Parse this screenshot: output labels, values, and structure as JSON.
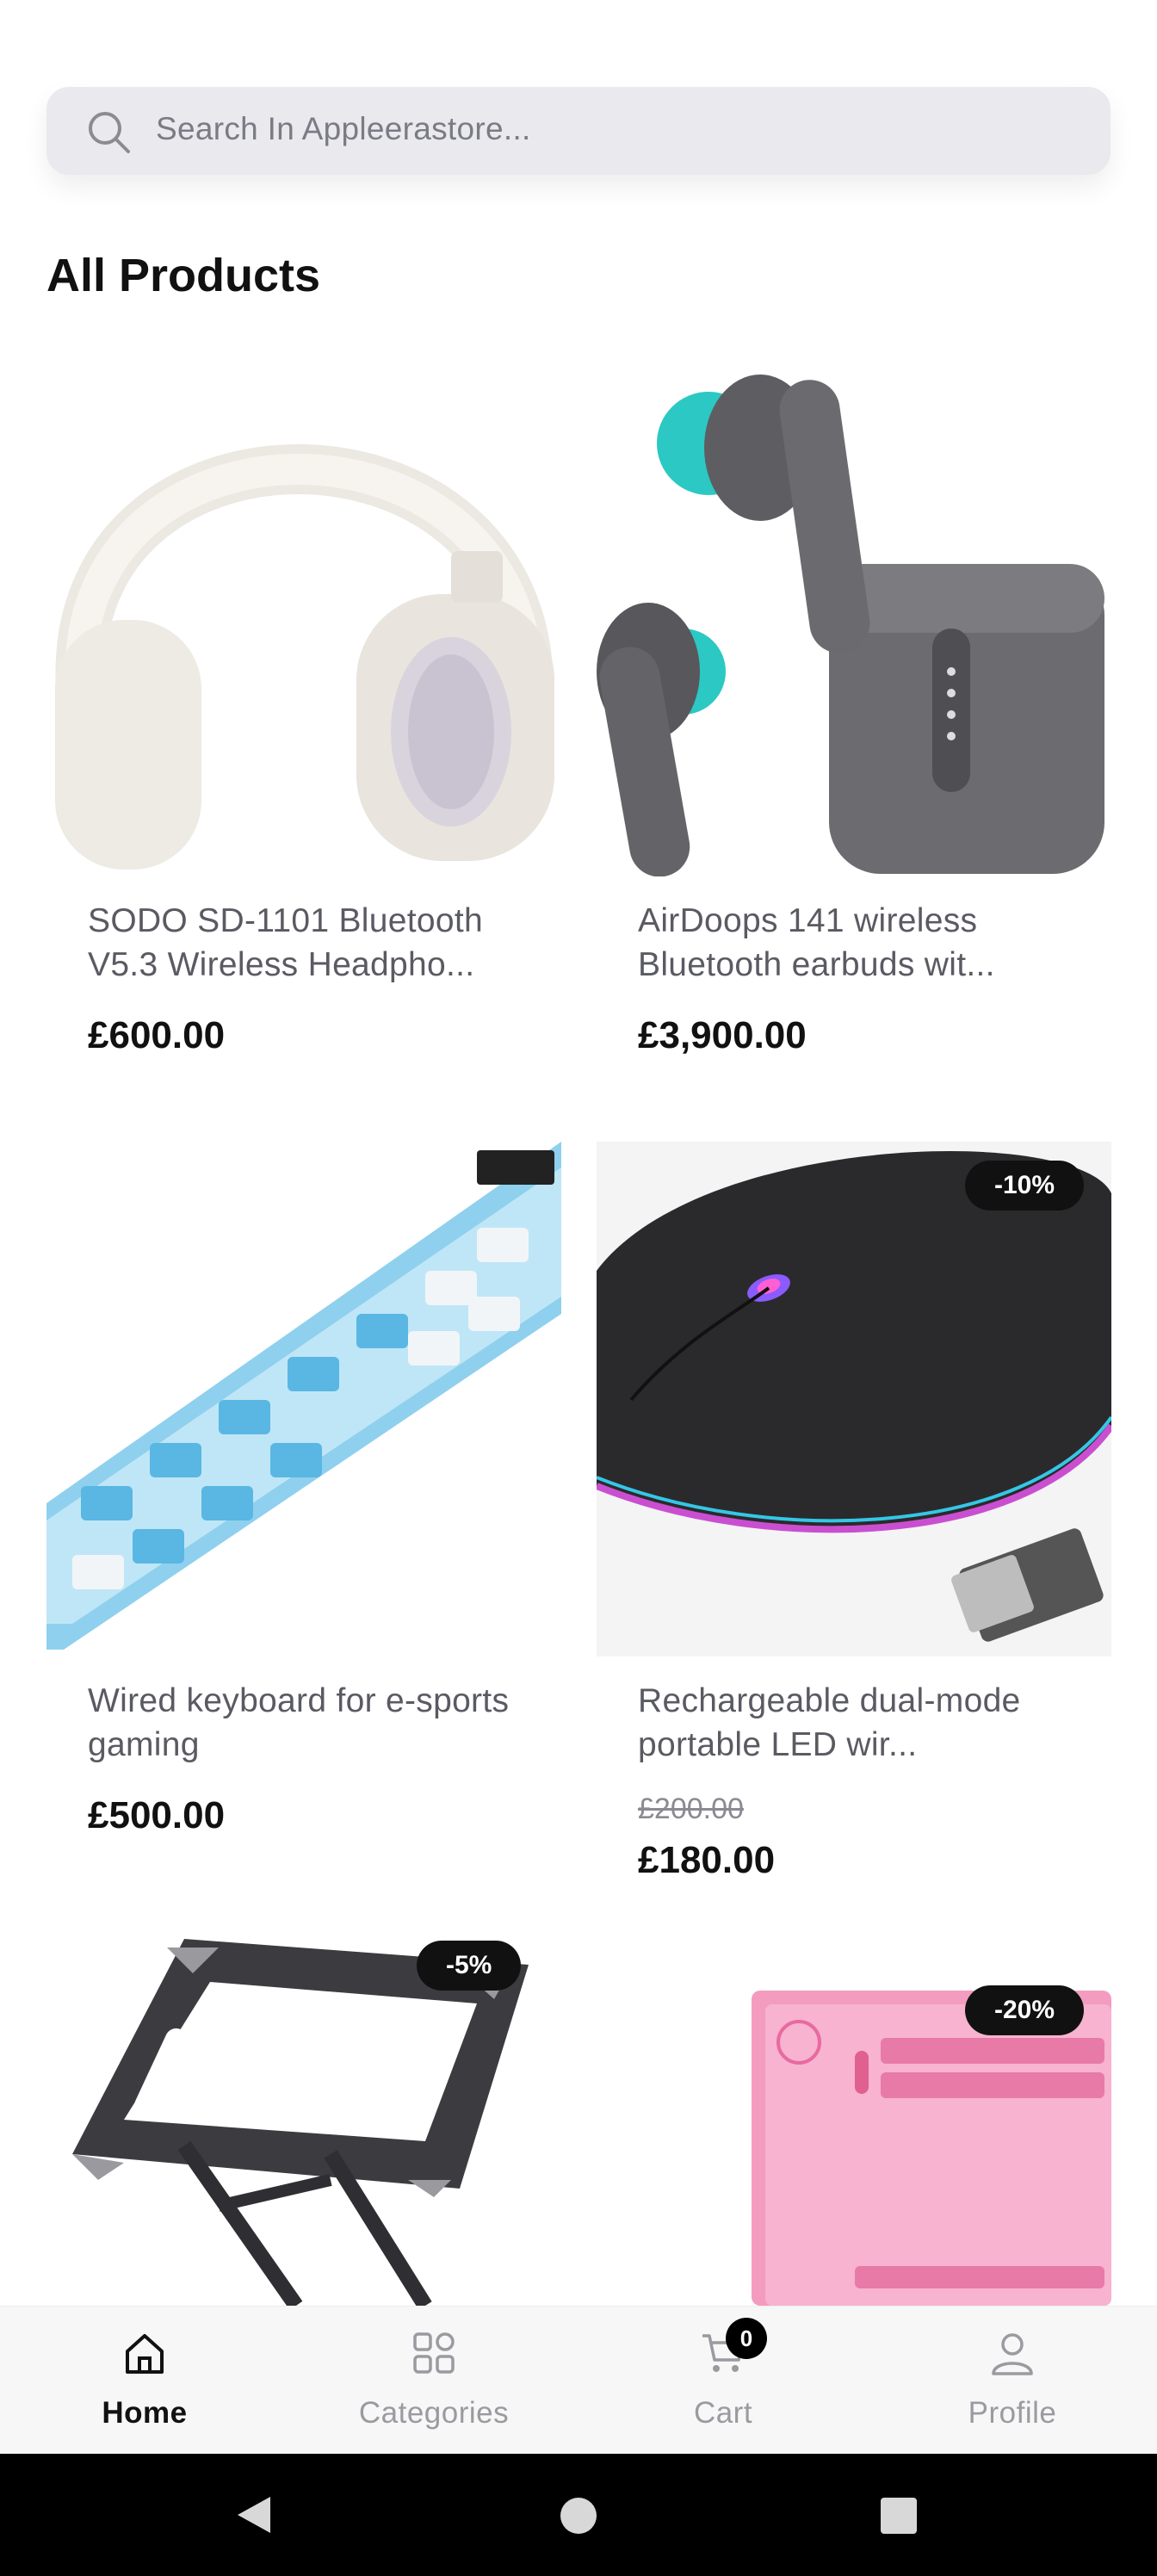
{
  "search": {
    "placeholder": "Search In Appleerastore..."
  },
  "section": {
    "title": "All Products"
  },
  "products": [
    {
      "name": "SODO SD-1101 Bluetooth V5.3 Wireless Headpho...",
      "price": "£600.00",
      "image": "white-headphones"
    },
    {
      "name": "AirDoops 141 wireless Bluetooth earbuds wit...",
      "price": "£3,900.00",
      "image": "grey-earbuds"
    },
    {
      "name": "Wired keyboard for e-sports gaming",
      "price": "£500.00",
      "image": "blue-keyboard"
    },
    {
      "name": "Rechargeable dual-mode portable LED wir...",
      "old_price": "£200.00",
      "price": "£180.00",
      "badge": "-10%",
      "image": "black-rgb-mouse"
    },
    {
      "badge": "-5%",
      "image": "laptop-stand"
    },
    {
      "badge": "-20%",
      "image": "pink-laptop-case"
    }
  ],
  "bottom_nav": {
    "items": [
      {
        "label": "Home",
        "icon": "home-icon",
        "active": true
      },
      {
        "label": "Categories",
        "icon": "grid-icon"
      },
      {
        "label": "Cart",
        "icon": "cart-icon"
      },
      {
        "label": "Profile",
        "icon": "user-icon"
      }
    ],
    "cart_count": "0"
  },
  "colors": {
    "accent": "#111111",
    "search_bg": "#e9e9ee",
    "nav_bg": "#f7f7f7",
    "muted": "#9a9aa0"
  }
}
